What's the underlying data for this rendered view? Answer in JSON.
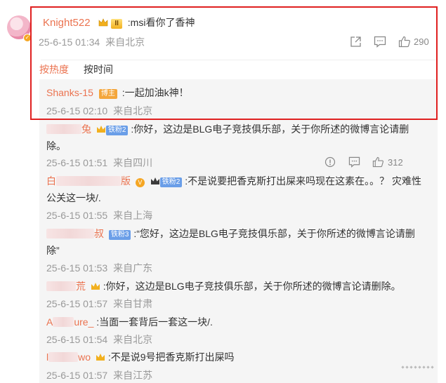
{
  "main_comment": {
    "username": "Knight522",
    "level_badge": "II",
    "text": ":msi看你了香神",
    "time": "25-6-15 01:34",
    "location": "来自北京",
    "like_count": "290"
  },
  "sort_tabs": {
    "hot": "按热度",
    "time": "按时间"
  },
  "pinned_reply": {
    "username": "Shanks-15",
    "role_badge": "博主",
    "text": ":一起加油k神！",
    "time": "25-6-15 02:10",
    "location": "来自北京"
  },
  "replies": [
    {
      "name_visible": "兔",
      "badge": "铁粉2",
      "text_line1": ":你好，这边是BLG电子竞技俱乐部，关于你所述的微博言论请删",
      "text_line2": "除。",
      "time": "25-6-15 01:51",
      "location": "来自四川",
      "like_count": "312"
    },
    {
      "name_prefix": "白",
      "name_visible": "版",
      "badge": "铁粉2",
      "text_line1": ":不是说要把香克斯打出屎来吗现在这素在。。？ 灾难性",
      "text_line2": "公关这一块/.",
      "time": "25-6-15 01:55",
      "location": "来自上海"
    },
    {
      "name_visible": "叔",
      "badge": "铁粉3",
      "text_line1": ":“您好，这边是BLG电子竞技俱乐部，关于你所述的微博言论请删",
      "text_line2": "除”",
      "time": "25-6-15 01:53",
      "location": "来自广东"
    },
    {
      "name_visible": "荒",
      "text_line1": ":你好，这边是BLG电子竞技俱乐部，关于你所述的微博言论请删除。",
      "time": "25-6-15 01:57",
      "location": "来自甘肃"
    },
    {
      "name_prefix": "A",
      "name_visible": "ure_",
      "text_line1": ":当面一套背后一套这一块/.",
      "time": "25-6-15 01:54",
      "location": "来自北京"
    },
    {
      "name_prefix": "l",
      "name_visible": "wo",
      "text_line1": ":不是说9号把香克斯打出屎吗",
      "time": "25-6-15 01:57",
      "location": "来自江苏"
    }
  ],
  "colors": {
    "username": "#eb7350",
    "highlight_border": "#e02020",
    "meta": "#999999",
    "reply_bg": "#f5f5f5"
  },
  "icons": [
    "share-icon",
    "comment-icon",
    "like-icon",
    "report-icon",
    "crown-icon",
    "verified-icon"
  ]
}
